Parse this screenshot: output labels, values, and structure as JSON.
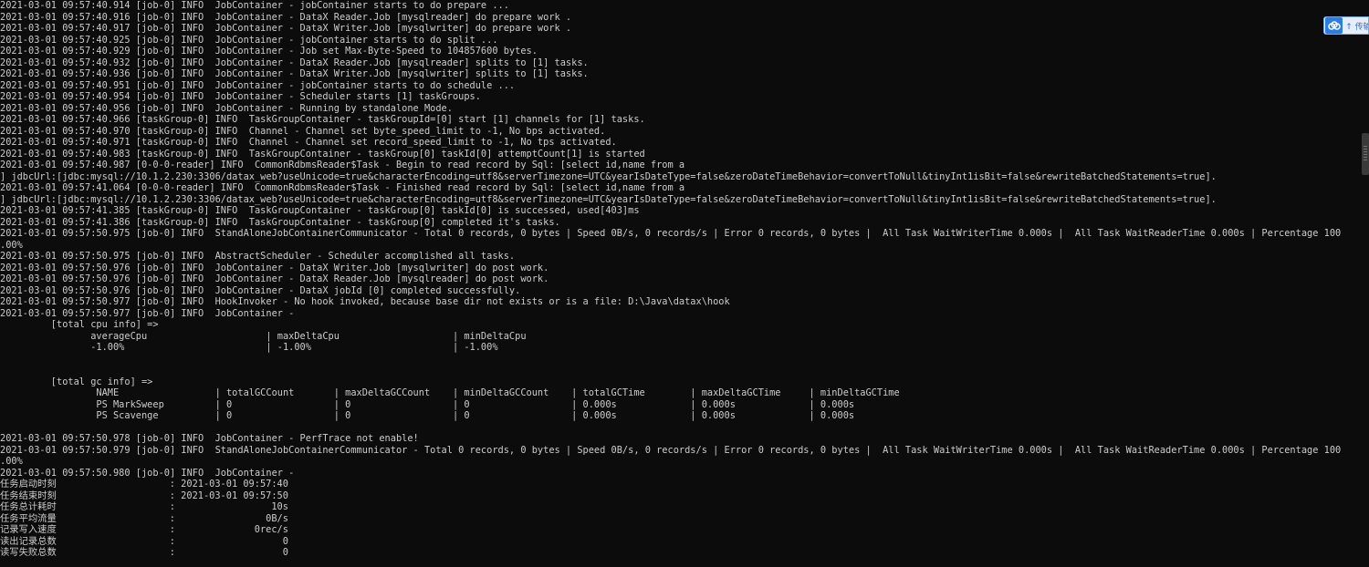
{
  "console": {
    "lines": [
      "2021-03-01 09:57:40.914 [job-0] INFO  JobContainer - jobContainer starts to do prepare ...",
      "2021-03-01 09:57:40.916 [job-0] INFO  JobContainer - DataX Reader.Job [mysqlreader] do prepare work .",
      "2021-03-01 09:57:40.917 [job-0] INFO  JobContainer - DataX Writer.Job [mysqlwriter] do prepare work .",
      "2021-03-01 09:57:40.925 [job-0] INFO  JobContainer - jobContainer starts to do split ...",
      "2021-03-01 09:57:40.929 [job-0] INFO  JobContainer - Job set Max-Byte-Speed to 104857600 bytes.",
      "2021-03-01 09:57:40.932 [job-0] INFO  JobContainer - DataX Reader.Job [mysqlreader] splits to [1] tasks.",
      "2021-03-01 09:57:40.936 [job-0] INFO  JobContainer - DataX Writer.Job [mysqlwriter] splits to [1] tasks.",
      "2021-03-01 09:57:40.951 [job-0] INFO  JobContainer - jobContainer starts to do schedule ...",
      "2021-03-01 09:57:40.954 [job-0] INFO  JobContainer - Scheduler starts [1] taskGroups.",
      "2021-03-01 09:57:40.956 [job-0] INFO  JobContainer - Running by standalone Mode.",
      "2021-03-01 09:57:40.966 [taskGroup-0] INFO  TaskGroupContainer - taskGroupId=[0] start [1] channels for [1] tasks.",
      "2021-03-01 09:57:40.970 [taskGroup-0] INFO  Channel - Channel set byte_speed_limit to -1, No bps activated.",
      "2021-03-01 09:57:40.971 [taskGroup-0] INFO  Channel - Channel set record_speed_limit to -1, No tps activated.",
      "2021-03-01 09:57:40.983 [taskGroup-0] INFO  TaskGroupContainer - taskGroup[0] taskId[0] attemptCount[1] is started",
      "2021-03-01 09:57:40.987 [0-0-0-reader] INFO  CommonRdbmsReader$Task - Begin to read record by Sql: [select id,name from a",
      "] jdbcUrl:[jdbc:mysql://10.1.2.230:3306/datax_web?useUnicode=true&characterEncoding=utf8&serverTimezone=UTC&yearIsDateType=false&zeroDateTimeBehavior=convertToNull&tinyInt1isBit=false&rewriteBatchedStatements=true].",
      "2021-03-01 09:57:41.064 [0-0-0-reader] INFO  CommonRdbmsReader$Task - Finished read record by Sql: [select id,name from a",
      "] jdbcUrl:[jdbc:mysql://10.1.2.230:3306/datax_web?useUnicode=true&characterEncoding=utf8&serverTimezone=UTC&yearIsDateType=false&zeroDateTimeBehavior=convertToNull&tinyInt1isBit=false&rewriteBatchedStatements=true].",
      "2021-03-01 09:57:41.385 [taskGroup-0] INFO  TaskGroupContainer - taskGroup[0] taskId[0] is successed, used[403]ms",
      "2021-03-01 09:57:41.386 [taskGroup-0] INFO  TaskGroupContainer - taskGroup[0] completed it's tasks.",
      "2021-03-01 09:57:50.975 [job-0] INFO  StandAloneJobContainerCommunicator - Total 0 records, 0 bytes | Speed 0B/s, 0 records/s | Error 0 records, 0 bytes |  All Task WaitWriterTime 0.000s |  All Task WaitReaderTime 0.000s | Percentage 100",
      ".00%",
      "2021-03-01 09:57:50.975 [job-0] INFO  AbstractScheduler - Scheduler accomplished all tasks.",
      "2021-03-01 09:57:50.976 [job-0] INFO  JobContainer - DataX Writer.Job [mysqlwriter] do post work.",
      "2021-03-01 09:57:50.976 [job-0] INFO  JobContainer - DataX Reader.Job [mysqlreader] do post work.",
      "2021-03-01 09:57:50.976 [job-0] INFO  JobContainer - DataX jobId [0] completed successfully.",
      "2021-03-01 09:57:50.977 [job-0] INFO  HookInvoker - No hook invoked, because base dir not exists or is a file: D:\\Java\\datax\\hook",
      "2021-03-01 09:57:50.977 [job-0] INFO  JobContainer - ",
      "         [total cpu info] =>",
      "                averageCpu                     | maxDeltaCpu                    | minDeltaCpu",
      "                -1.00%                         | -1.00%                         | -1.00%",
      "",
      "",
      "         [total gc info] =>",
      "                 NAME                 | totalGCCount       | maxDeltaGCCount    | minDeltaGCCount    | totalGCTime        | maxDeltaGCTime     | minDeltaGCTime",
      "                 PS MarkSweep         | 0                  | 0                  | 0                  | 0.000s             | 0.000s             | 0.000s",
      "                 PS Scavenge          | 0                  | 0                  | 0                  | 0.000s             | 0.000s             | 0.000s",
      "",
      "2021-03-01 09:57:50.978 [job-0] INFO  JobContainer - PerfTrace not enable!",
      "2021-03-01 09:57:50.979 [job-0] INFO  StandAloneJobContainerCommunicator - Total 0 records, 0 bytes | Speed 0B/s, 0 records/s | Error 0 records, 0 bytes |  All Task WaitWriterTime 0.000s |  All Task WaitReaderTime 0.000s | Percentage 100",
      ".00%",
      "2021-03-01 09:57:50.980 [job-0] INFO  JobContainer - ",
      "任务启动时刻                    : 2021-03-01 09:57:40",
      "任务结束时刻                    : 2021-03-01 09:57:50",
      "任务总计耗时                    :                 10s",
      "任务平均流量                    :                0B/s",
      "记录写入速度                    :              0rec/s",
      "读出记录总数                    :                   0",
      "读写失败总数                    :                   0"
    ]
  },
  "floating_widget": {
    "icon": "cloud-icon",
    "label": "↑ 传输",
    "accent_color": "#2d7de0"
  },
  "scrollbar": {
    "grip_icon": "grip-icon"
  }
}
